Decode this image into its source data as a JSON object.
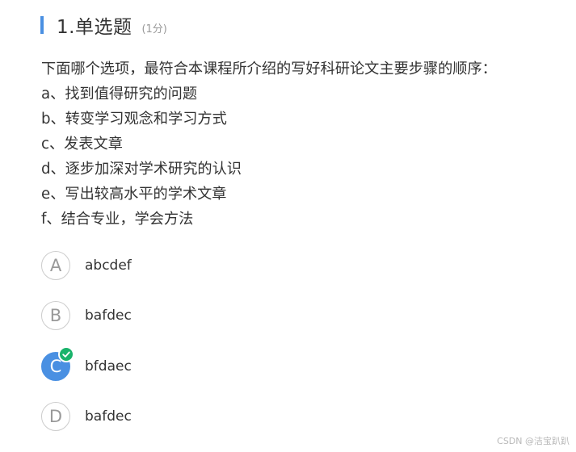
{
  "question": {
    "title": "1.单选题",
    "score": "(1分)",
    "stem_lines": [
      "下面哪个选项，最符合本课程所介绍的写好科研论文主要步骤的顺序：",
      "a、找到值得研究的问题",
      "b、转变学习观念和学习方式",
      "c、发表文章",
      "d、逐步加深对学术研究的认识",
      "e、写出较高水平的学术文章",
      "f、结合专业，学会方法"
    ],
    "options": [
      {
        "letter": "A",
        "text": "abcdef",
        "selected": false
      },
      {
        "letter": "B",
        "text": "bafdec",
        "selected": false
      },
      {
        "letter": "C",
        "text": "bfdaec",
        "selected": true
      },
      {
        "letter": "D",
        "text": "bafdec",
        "selected": false
      }
    ]
  },
  "watermark": "CSDN @洁宝趴趴",
  "colors": {
    "accent": "#4a90e2",
    "correct": "#19b36b"
  },
  "icons": {
    "correct_badge": "check-icon"
  }
}
